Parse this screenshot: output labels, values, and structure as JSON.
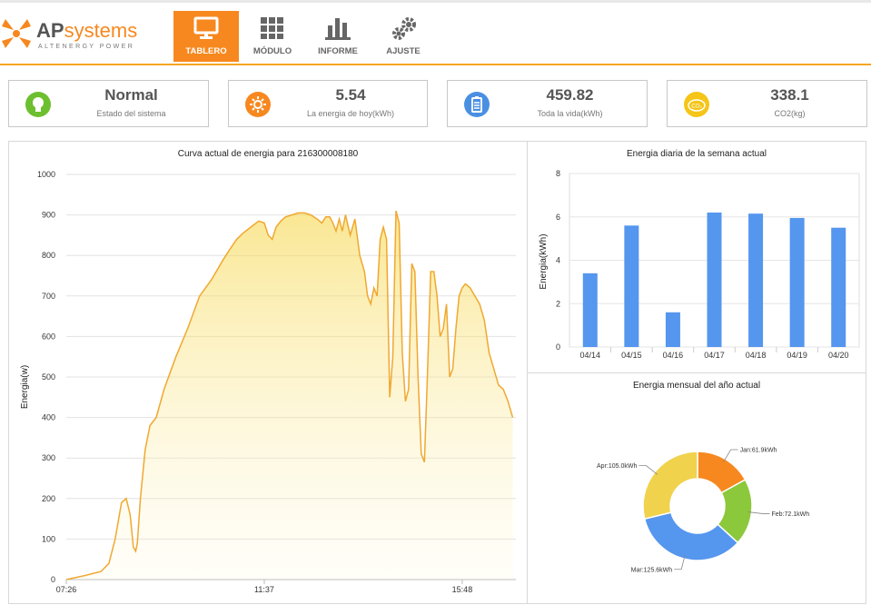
{
  "brand": {
    "name": "APsystems",
    "tagline": "ALTENERGY POWER"
  },
  "nav": [
    {
      "label": "TABLERO",
      "active": true,
      "icon": "monitor-icon"
    },
    {
      "label": "MÓDULO",
      "active": false,
      "icon": "grid-icon"
    },
    {
      "label": "INFORME",
      "active": false,
      "icon": "bar-chart-icon"
    },
    {
      "label": "AJUSTE",
      "active": false,
      "icon": "gears-icon"
    }
  ],
  "cards": [
    {
      "value": "Normal",
      "label": "Estado del sistema",
      "icon": "lightbulb-icon",
      "color": "#6cbf2e"
    },
    {
      "value": "5.54",
      "label": "La energia de hoy(kWh)",
      "icon": "sun-icon",
      "color": "#f7881f"
    },
    {
      "value": "459.82",
      "label": "Toda la vida(kWh)",
      "icon": "battery-icon",
      "color": "#4a90e2"
    },
    {
      "value": "338.1",
      "label": "CO2(kg)",
      "icon": "co2-icon",
      "color": "#f5c518"
    }
  ],
  "colors": {
    "accent": "#f7881f",
    "line": "#f0a830",
    "bar": "#5596ee"
  },
  "chart_data": [
    {
      "type": "area",
      "title": "Curva actual de energia para 216300008180",
      "ylabel": "Energia(w)",
      "ylim": [
        0,
        1000
      ],
      "yticks": [
        0,
        100,
        200,
        300,
        400,
        500,
        600,
        700,
        800,
        900,
        1000
      ],
      "xticks": [
        "07:26",
        "11:37",
        "15:48"
      ],
      "xlim_minutes": [
        446,
        1016
      ],
      "x_minutes": [
        446,
        470,
        490,
        500,
        508,
        516,
        522,
        527,
        531,
        534,
        536,
        540,
        546,
        552,
        560,
        570,
        585,
        600,
        615,
        630,
        645,
        655,
        662,
        670,
        680,
        690,
        697,
        702,
        707,
        712,
        718,
        724,
        732,
        740,
        748,
        756,
        764,
        770,
        775,
        780,
        784,
        788,
        792,
        796,
        800,
        806,
        812,
        818,
        824,
        828,
        832,
        836,
        840,
        844,
        848,
        852,
        856,
        860,
        864,
        868,
        872,
        876,
        880,
        884,
        888,
        892,
        896,
        900,
        904,
        908,
        912,
        916,
        920,
        924,
        928,
        932,
        936,
        940,
        944,
        948,
        952,
        958,
        964,
        970,
        976,
        982,
        988,
        994,
        1000,
        1006,
        1012
      ],
      "y_values": [
        0,
        10,
        20,
        40,
        100,
        190,
        200,
        160,
        80,
        70,
        90,
        200,
        320,
        380,
        400,
        470,
        550,
        620,
        700,
        740,
        790,
        820,
        840,
        855,
        870,
        885,
        880,
        850,
        840,
        870,
        885,
        895,
        900,
        905,
        905,
        900,
        890,
        880,
        895,
        895,
        880,
        860,
        890,
        860,
        900,
        850,
        890,
        800,
        760,
        700,
        680,
        720,
        700,
        840,
        870,
        840,
        450,
        550,
        910,
        880,
        560,
        440,
        470,
        780,
        760,
        500,
        310,
        290,
        510,
        760,
        760,
        700,
        600,
        620,
        680,
        500,
        520,
        620,
        700,
        720,
        730,
        720,
        700,
        680,
        640,
        560,
        520,
        480,
        470,
        440,
        400
      ]
    },
    {
      "type": "bar",
      "title": "Energia diaria de la semana actual",
      "ylabel": "Energia(kWh)",
      "ylim": [
        0,
        8
      ],
      "yticks": [
        0,
        2,
        4,
        6,
        8
      ],
      "categories": [
        "04/14",
        "04/15",
        "04/16",
        "04/17",
        "04/18",
        "04/19",
        "04/20"
      ],
      "values": [
        3.4,
        5.6,
        1.6,
        6.2,
        6.15,
        5.95,
        5.5
      ]
    },
    {
      "type": "pie",
      "title": "Energia mensual del año actual",
      "slices": [
        {
          "label": "Jan:61.9kWh",
          "value": 61.9,
          "color": "#f7881f"
        },
        {
          "label": "Feb:72.1kWh",
          "value": 72.1,
          "color": "#8cc83b"
        },
        {
          "label": "Mar:125.6kWh",
          "value": 125.6,
          "color": "#5596ee"
        },
        {
          "label": "Apr:105.0kWh",
          "value": 105.0,
          "color": "#f0d24d"
        }
      ]
    }
  ]
}
